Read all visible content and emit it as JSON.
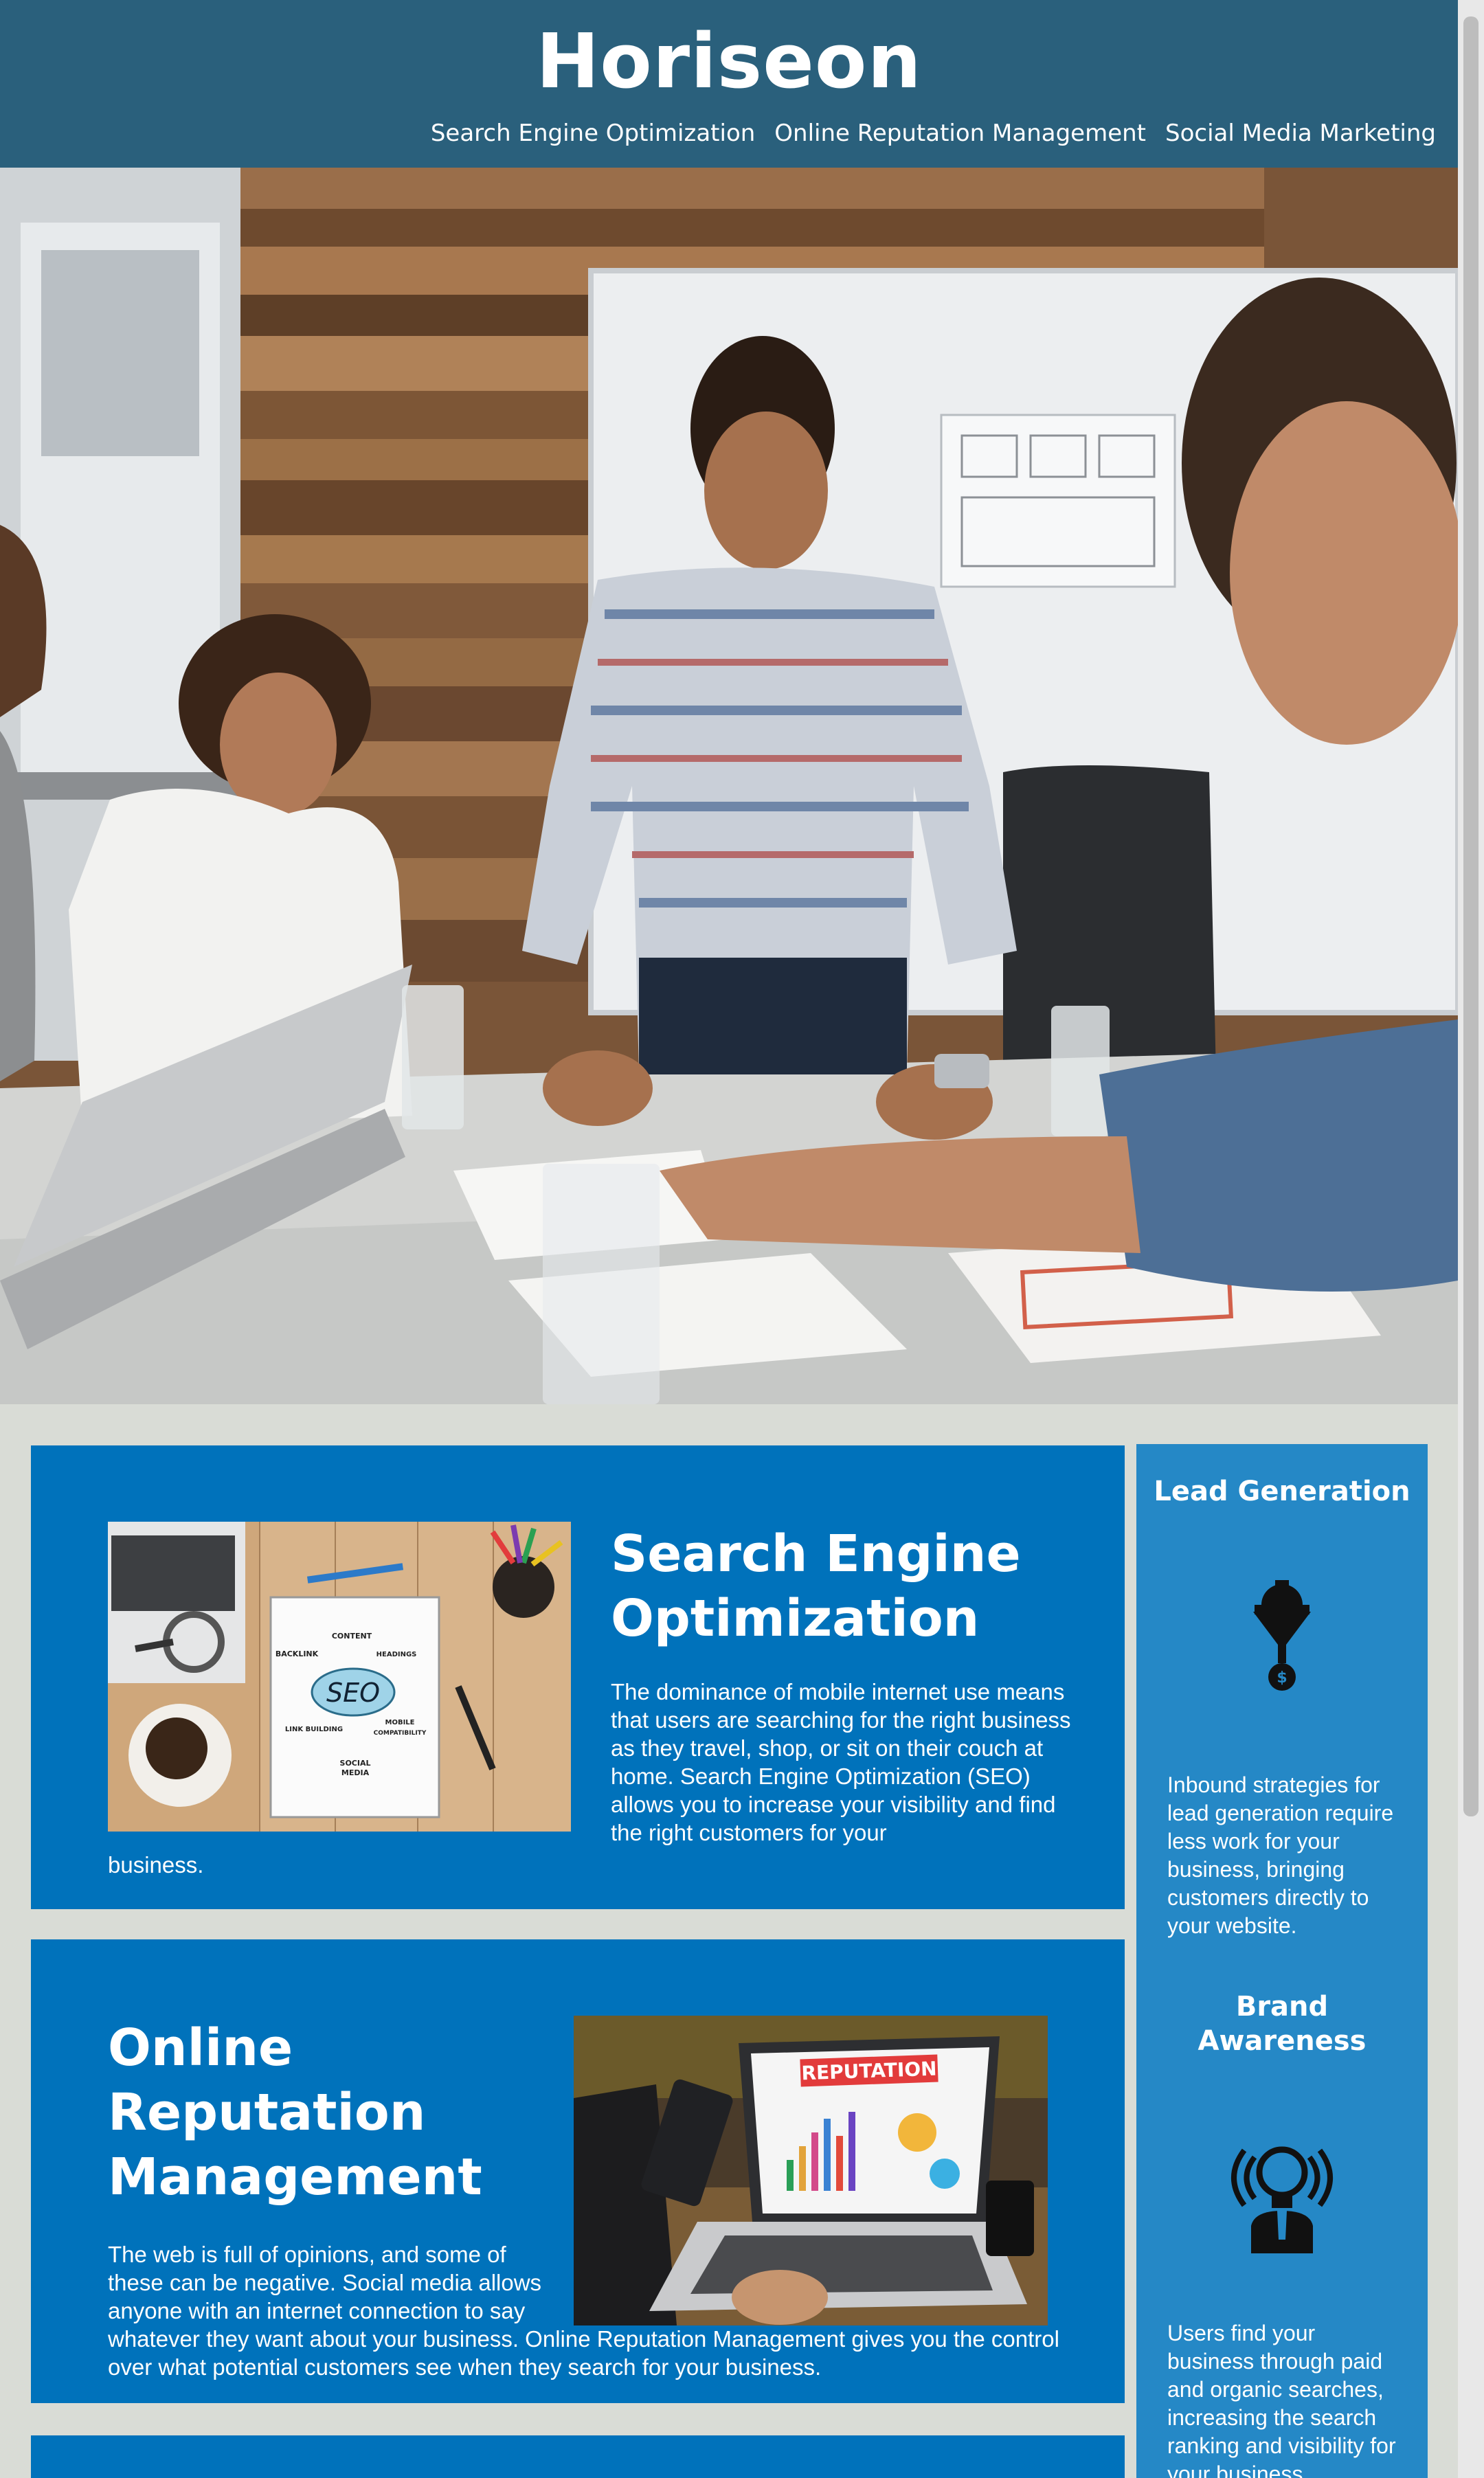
{
  "header": {
    "logo": "Horiseon",
    "nav": [
      {
        "label": "Search Engine Optimization"
      },
      {
        "label": "Online Reputation Management"
      },
      {
        "label": "Social Media Marketing"
      }
    ]
  },
  "sections": [
    {
      "heading": "Search Engine Optimization",
      "text_wrapped": "The dominance of mobile internet use means that users are searching for the right business as they travel, shop, or sit on their couch at home. Search Engine Optimization (SEO) allows you to increase your visibility and find the right customers for your",
      "text_tail": "business.",
      "image_words": [
        "CONTENT",
        "HEADINGS",
        "BACKLINK",
        "SEO",
        "MOBILE",
        "COMPATIBILITY",
        "LINK BUILDING",
        "SOCIAL",
        "MEDIA"
      ]
    },
    {
      "heading": "Online Reputation Management",
      "text_wrapped": "The web is full of opinions, and some of these can be negative. Social media allows anyone with an internet connection to say",
      "text_tail": "whatever they want about your business. Online Reputation Management gives you the control over what potential customers see when they search for your business.",
      "image_words": [
        "REPUTATION"
      ]
    }
  ],
  "benefits": [
    {
      "title": "Lead Generation",
      "icon": "lead-generation-icon",
      "text": "Inbound strategies for lead generation require less work for your business, bringing customers directly to your website."
    },
    {
      "title": "Brand Awareness",
      "icon": "brand-awareness-icon",
      "text": "Users find your business through paid and organic searches, increasing the search ranking and visibility for your business."
    }
  ],
  "colors": {
    "header_bg": "#2a607c",
    "content_bg": "#0072bb",
    "benefits_bg": "#2588c6",
    "page_bg": "#d9dcd6"
  }
}
